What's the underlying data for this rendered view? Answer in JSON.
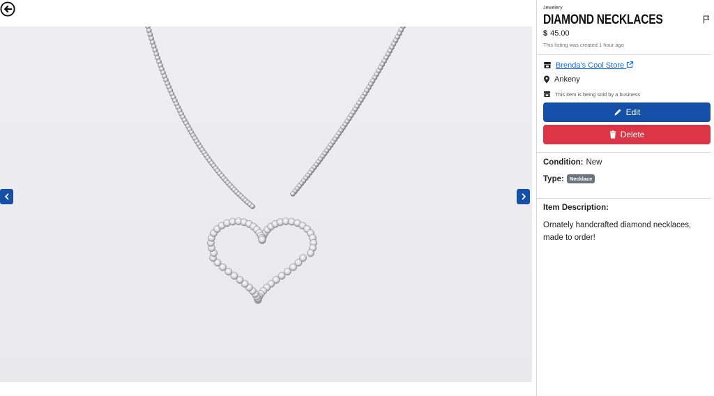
{
  "listing": {
    "category": "Jewelery",
    "title": "DIAMOND NECKLACES",
    "currency_symbol": "$",
    "price": "45.00",
    "created": "This listing was created 1 hour ago"
  },
  "seller": {
    "store_name": "Brenda's Cool Store",
    "location": "Ankeny",
    "business_note": "This item is being sold by a business"
  },
  "actions": {
    "edit_label": "Edit",
    "delete_label": "Delete"
  },
  "details": {
    "condition_label": "Condition:",
    "condition_value": "New",
    "type_label": "Type:",
    "type_value": "Necklace"
  },
  "description": {
    "heading": "Item Description:",
    "text": "Ornately handcrafted diamond necklaces, made to order!"
  },
  "icons": {
    "back": "circle-arrow-left-icon",
    "flag": "flag-icon",
    "store": "store-icon",
    "external": "external-link-icon",
    "location": "map-pin-icon",
    "edit": "pencil-icon",
    "delete": "trash-icon",
    "prev": "chevron-left-icon",
    "next": "chevron-right-icon"
  },
  "colors": {
    "primary": "#1450a8",
    "danger": "#dc3545",
    "link": "#0d6efd",
    "badge": "#6c757d"
  }
}
